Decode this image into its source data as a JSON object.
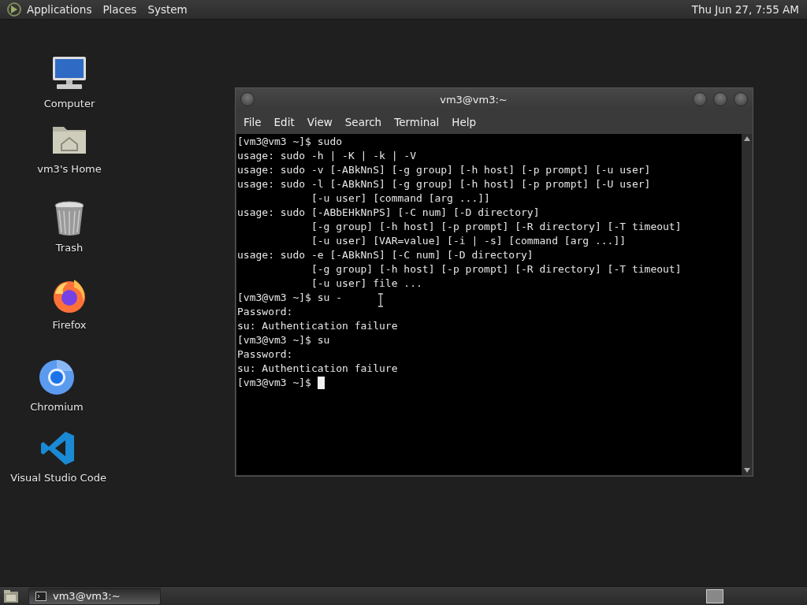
{
  "top_panel": {
    "menus": [
      "Applications",
      "Places",
      "System"
    ],
    "clock": "Thu Jun 27, 7:55 AM"
  },
  "desktop_icons": [
    {
      "kind": "computer",
      "label": "Computer"
    },
    {
      "kind": "home",
      "label": "vm3's Home"
    },
    {
      "kind": "trash",
      "label": "Trash"
    },
    {
      "kind": "firefox",
      "label": "Firefox"
    },
    {
      "kind": "chromium",
      "label": "Chromium"
    },
    {
      "kind": "vscode",
      "label": "Visual Studio Code"
    }
  ],
  "terminal": {
    "title": "vm3@vm3:~",
    "menu": [
      "File",
      "Edit",
      "View",
      "Search",
      "Terminal",
      "Help"
    ],
    "lines": [
      "[vm3@vm3 ~]$ sudo",
      "usage: sudo -h | -K | -k | -V",
      "usage: sudo -v [-ABkNnS] [-g group] [-h host] [-p prompt] [-u user]",
      "usage: sudo -l [-ABkNnS] [-g group] [-h host] [-p prompt] [-U user]",
      "            [-u user] [command [arg ...]]",
      "usage: sudo [-ABbEHkNnPS] [-C num] [-D directory]",
      "            [-g group] [-h host] [-p prompt] [-R directory] [-T timeout]",
      "            [-u user] [VAR=value] [-i | -s] [command [arg ...]]",
      "usage: sudo -e [-ABkNnS] [-C num] [-D directory]",
      "            [-g group] [-h host] [-p prompt] [-R directory] [-T timeout]",
      "            [-u user] file ...",
      "[vm3@vm3 ~]$ su -",
      "Password:",
      "su: Authentication failure",
      "[vm3@vm3 ~]$ su",
      "Password:",
      "su: Authentication failure",
      "[vm3@vm3 ~]$"
    ]
  },
  "taskbar": {
    "tasks": [
      {
        "label": "vm3@vm3:~",
        "selected": true
      }
    ]
  }
}
